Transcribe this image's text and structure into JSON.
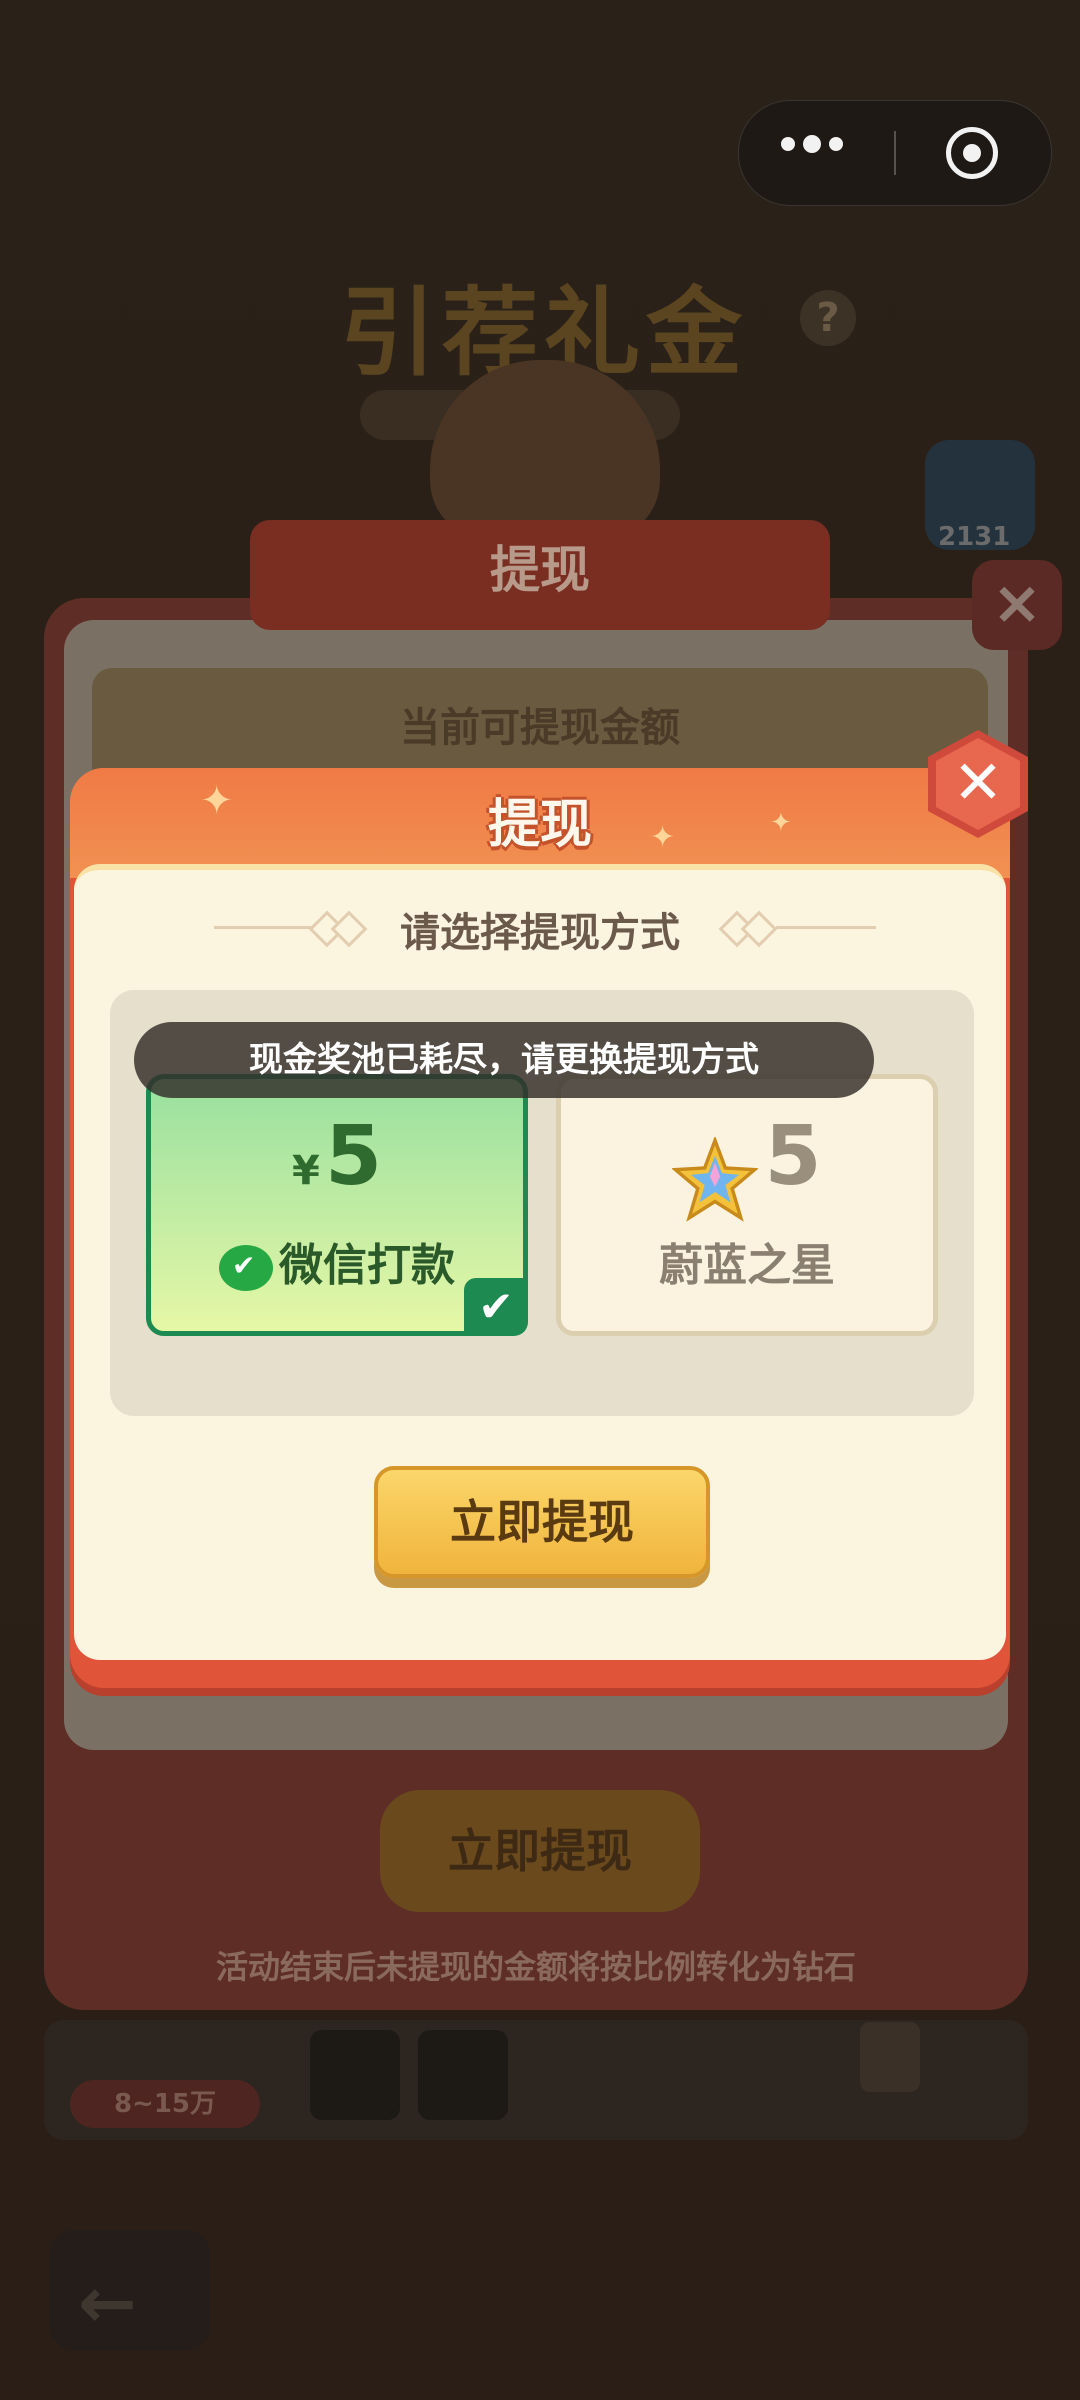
{
  "background": {
    "page_title": "引荐礼金",
    "help_mark": "?",
    "right_badge_count": "2131",
    "panel_title": "提现",
    "panel_amount_label": "当前可提现金额",
    "panel_withdraw_button": "立即提现",
    "panel_note": "活动结束后未提现的金额将按比例转化为钻石",
    "bottom_range": "8~15万"
  },
  "dialog": {
    "title": "提现",
    "choose_label": "请选择提现方式",
    "toast": "现金奖池已耗尽，请更换提现方式",
    "options": [
      {
        "currency": "¥",
        "amount": "5",
        "label": "微信打款",
        "selected": true,
        "icon": "wechat-icon"
      },
      {
        "amount": "5",
        "label": "蔚蓝之星",
        "selected": false,
        "icon": "star-icon"
      }
    ],
    "withdraw_button": "立即提现"
  },
  "colors": {
    "dialog_red": "#e0553a",
    "selected_border": "#1d8a52",
    "button_gold": "#f0b43c"
  }
}
